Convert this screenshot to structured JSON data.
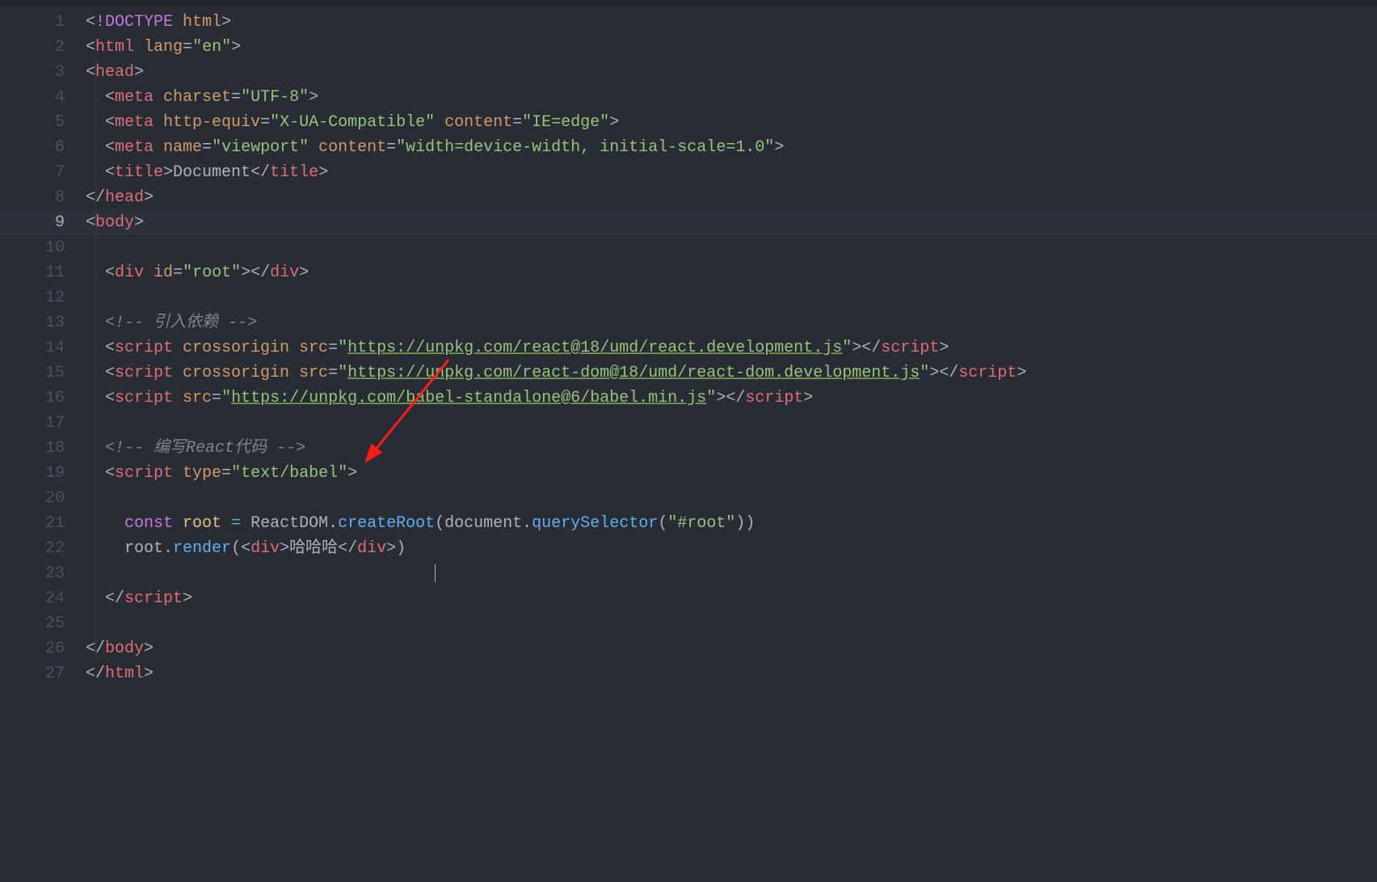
{
  "lines": {
    "1": [
      [
        "c-punc",
        "<"
      ],
      [
        "c-doc",
        "!DOCTYPE "
      ],
      [
        "c-attr",
        "html"
      ],
      [
        "c-punc",
        ">"
      ]
    ],
    "2": [
      [
        "c-punc",
        "<"
      ],
      [
        "c-tag",
        "html "
      ],
      [
        "c-attr",
        "lang"
      ],
      [
        "c-punc",
        "="
      ],
      [
        "c-str",
        "\"en\""
      ],
      [
        "c-punc",
        ">"
      ]
    ],
    "3": [
      [
        "c-punc",
        "<"
      ],
      [
        "c-tag",
        "head"
      ],
      [
        "c-punc",
        ">"
      ]
    ],
    "4": [
      [
        "c-punc",
        "  <"
      ],
      [
        "c-tag",
        "meta "
      ],
      [
        "c-attr",
        "charset"
      ],
      [
        "c-punc",
        "="
      ],
      [
        "c-str",
        "\"UTF-8\""
      ],
      [
        "c-punc",
        ">"
      ]
    ],
    "5": [
      [
        "c-punc",
        "  <"
      ],
      [
        "c-tag",
        "meta "
      ],
      [
        "c-attr",
        "http-equiv"
      ],
      [
        "c-punc",
        "="
      ],
      [
        "c-str",
        "\"X-UA-Compatible\" "
      ],
      [
        "c-attr",
        "content"
      ],
      [
        "c-punc",
        "="
      ],
      [
        "c-str",
        "\"IE=edge\""
      ],
      [
        "c-punc",
        ">"
      ]
    ],
    "6": [
      [
        "c-punc",
        "  <"
      ],
      [
        "c-tag",
        "meta "
      ],
      [
        "c-attr",
        "name"
      ],
      [
        "c-punc",
        "="
      ],
      [
        "c-str",
        "\"viewport\" "
      ],
      [
        "c-attr",
        "content"
      ],
      [
        "c-punc",
        "="
      ],
      [
        "c-str",
        "\"width=device-width, initial-scale=1.0\""
      ],
      [
        "c-punc",
        ">"
      ]
    ],
    "7": [
      [
        "c-punc",
        "  <"
      ],
      [
        "c-tag",
        "title"
      ],
      [
        "c-punc",
        ">"
      ],
      [
        "c-id",
        "Document"
      ],
      [
        "c-punc",
        "</"
      ],
      [
        "c-tag",
        "title"
      ],
      [
        "c-punc",
        ">"
      ]
    ],
    "8": [
      [
        "c-punc",
        "</"
      ],
      [
        "c-tag",
        "head"
      ],
      [
        "c-punc",
        ">"
      ]
    ],
    "9": [
      [
        "c-punc",
        "<"
      ],
      [
        "c-tag",
        "body"
      ],
      [
        "c-punc",
        ">"
      ]
    ],
    "10": [
      [
        "c-punc",
        ""
      ]
    ],
    "11": [
      [
        "c-punc",
        "  <"
      ],
      [
        "c-tag",
        "div "
      ],
      [
        "c-attr",
        "id"
      ],
      [
        "c-punc",
        "="
      ],
      [
        "c-str",
        "\"root\""
      ],
      [
        "c-punc",
        "></"
      ],
      [
        "c-tag",
        "div"
      ],
      [
        "c-punc",
        ">"
      ]
    ],
    "12": [
      [
        "c-punc",
        ""
      ]
    ],
    "13": [
      [
        "c-punc",
        "  "
      ],
      [
        "c-cmt",
        "<!-- 引入依赖 -->"
      ]
    ],
    "14": [
      [
        "c-punc",
        "  <"
      ],
      [
        "c-tag",
        "script "
      ],
      [
        "c-attr",
        "crossorigin src"
      ],
      [
        "c-punc",
        "="
      ],
      [
        "c-str",
        "\""
      ],
      [
        "c-link",
        "https://unpkg.com/react@18/umd/react.development.js"
      ],
      [
        "c-str",
        "\""
      ],
      [
        "c-punc",
        "></"
      ],
      [
        "c-tag",
        "script"
      ],
      [
        "c-punc",
        ">"
      ]
    ],
    "15": [
      [
        "c-punc",
        "  <"
      ],
      [
        "c-tag",
        "script "
      ],
      [
        "c-attr",
        "crossorigin src"
      ],
      [
        "c-punc",
        "="
      ],
      [
        "c-str",
        "\""
      ],
      [
        "c-link",
        "https://unpkg.com/react-dom@18/umd/react-dom.development.js"
      ],
      [
        "c-str",
        "\""
      ],
      [
        "c-punc",
        "></"
      ],
      [
        "c-tag",
        "script"
      ],
      [
        "c-punc",
        ">"
      ]
    ],
    "16": [
      [
        "c-punc",
        "  <"
      ],
      [
        "c-tag",
        "script "
      ],
      [
        "c-attr",
        "src"
      ],
      [
        "c-punc",
        "="
      ],
      [
        "c-str",
        "\""
      ],
      [
        "c-link",
        "https://unpkg.com/babel-standalone@6/babel.min.js"
      ],
      [
        "c-str",
        "\""
      ],
      [
        "c-punc",
        "></"
      ],
      [
        "c-tag",
        "script"
      ],
      [
        "c-punc",
        ">"
      ]
    ],
    "17": [
      [
        "c-punc",
        ""
      ]
    ],
    "18": [
      [
        "c-punc",
        "  "
      ],
      [
        "c-cmt",
        "<!-- 编写React代码 -->"
      ]
    ],
    "19": [
      [
        "c-punc",
        "  <"
      ],
      [
        "c-tag",
        "script "
      ],
      [
        "c-attr",
        "type"
      ],
      [
        "c-punc",
        "="
      ],
      [
        "c-str",
        "\"text/babel\""
      ],
      [
        "c-punc",
        ">"
      ]
    ],
    "20": [
      [
        "c-punc",
        ""
      ]
    ],
    "21": [
      [
        "c-punc",
        "    "
      ],
      [
        "c-kw",
        "const "
      ],
      [
        "c-var",
        "root "
      ],
      [
        "c-eq",
        "= "
      ],
      [
        "c-id",
        "ReactDOM"
      ],
      [
        "c-punc",
        "."
      ],
      [
        "c-fn",
        "createRoot"
      ],
      [
        "c-punc",
        "("
      ],
      [
        "c-id",
        "document"
      ],
      [
        "c-punc",
        "."
      ],
      [
        "c-fn",
        "querySelector"
      ],
      [
        "c-punc",
        "("
      ],
      [
        "c-str",
        "\"#root\""
      ],
      [
        "c-punc",
        "))"
      ]
    ],
    "22": [
      [
        "c-punc",
        "    "
      ],
      [
        "c-id",
        "root"
      ],
      [
        "c-punc",
        "."
      ],
      [
        "c-fn",
        "render"
      ],
      [
        "c-punc",
        "(<"
      ],
      [
        "c-tag",
        "div"
      ],
      [
        "c-punc",
        ">"
      ],
      [
        "c-id",
        "哈哈哈"
      ],
      [
        "c-punc",
        "</"
      ],
      [
        "c-tag",
        "div"
      ],
      [
        "c-punc",
        ">)"
      ]
    ],
    "23": [
      [
        "c-punc",
        ""
      ]
    ],
    "24": [
      [
        "c-punc",
        "  </"
      ],
      [
        "c-tag",
        "script"
      ],
      [
        "c-punc",
        ">"
      ]
    ],
    "25": [
      [
        "c-punc",
        ""
      ]
    ],
    "26": [
      [
        "c-punc",
        "</"
      ],
      [
        "c-tag",
        "body"
      ],
      [
        "c-punc",
        ">"
      ]
    ],
    "27": [
      [
        "c-punc",
        "</"
      ],
      [
        "c-tag",
        "html"
      ],
      [
        "c-punc",
        ">"
      ]
    ]
  },
  "current_line": 9,
  "first_line": 1,
  "last_line": 27
}
